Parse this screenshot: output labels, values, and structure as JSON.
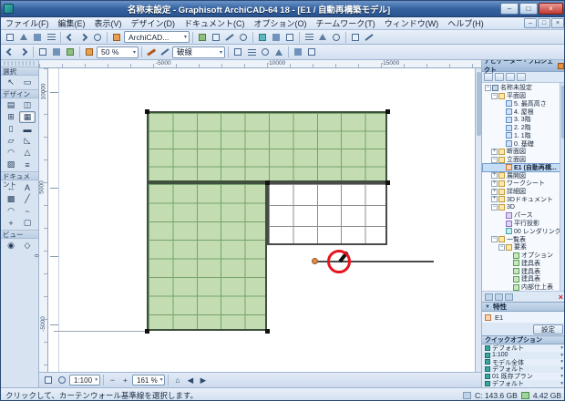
{
  "window": {
    "title": "名称未設定 - Graphisoft ArchiCAD-64 18 - [E1 / 自動再構築モデル]"
  },
  "icons": {
    "minimize": "–",
    "maximize": "□",
    "close": "×",
    "dropdown": "▾",
    "collapse": "▼",
    "zoom_out": "−",
    "zoom_in": "+",
    "fit": "⌂",
    "pan_left": "◀",
    "pan_right": "▶"
  },
  "menu": {
    "items": [
      "ファイル(F)",
      "編集(E)",
      "表示(V)",
      "デザイン(D)",
      "ドキュメント(C)",
      "オプション(O)",
      "チームワーク(T)",
      "ウィンドウ(W)",
      "ヘルプ(H)"
    ]
  },
  "toolbars": {
    "profile_combo": "ArchiCAD...",
    "scale_combo": "50 %",
    "linetype_combo": "破線"
  },
  "palette": {
    "sections": [
      {
        "label": "選択",
        "tools": [
          {
            "name": "arrow",
            "glyph": "↖"
          },
          {
            "name": "marquee",
            "glyph": "▭"
          }
        ]
      },
      {
        "label": "デザイン",
        "tools": [
          {
            "name": "wall",
            "glyph": "▤"
          },
          {
            "name": "door",
            "glyph": "◫"
          },
          {
            "name": "window",
            "glyph": "⊞"
          },
          {
            "name": "curtain-wall",
            "glyph": "▦"
          },
          {
            "name": "column",
            "glyph": "▯"
          },
          {
            "name": "beam",
            "glyph": "▬"
          },
          {
            "name": "slab",
            "glyph": "▱"
          },
          {
            "name": "roof",
            "glyph": "◺"
          },
          {
            "name": "shell",
            "glyph": "◠"
          },
          {
            "name": "mesh",
            "glyph": "△"
          },
          {
            "name": "zone",
            "glyph": "▨"
          },
          {
            "name": "stair",
            "glyph": "≡"
          }
        ]
      },
      {
        "label": "ドキュメント",
        "tools": [
          {
            "name": "dimension",
            "glyph": "↔"
          },
          {
            "name": "text",
            "glyph": "A"
          },
          {
            "name": "fill",
            "glyph": "▩"
          },
          {
            "name": "line",
            "glyph": "╱"
          },
          {
            "name": "arc",
            "glyph": "◠"
          },
          {
            "name": "spline",
            "glyph": "~"
          },
          {
            "name": "hotspot",
            "glyph": "+"
          },
          {
            "name": "figure",
            "glyph": "▢"
          }
        ]
      },
      {
        "label": "ビュー",
        "tools": [
          {
            "name": "camera",
            "glyph": "◉"
          },
          {
            "name": "path",
            "glyph": "◇"
          }
        ]
      }
    ]
  },
  "rulers": {
    "top": [
      "-5000",
      "-10000",
      "-15000"
    ],
    "left": [
      "10000",
      "5000",
      "0",
      "-5000"
    ]
  },
  "navigator": {
    "title": "ナビゲーター - プロジェクト",
    "tree": [
      {
        "label": "名称未設定"
      },
      {
        "label": "平面図"
      },
      {
        "label": "5. 最高高さ"
      },
      {
        "label": "4. 屋根"
      },
      {
        "label": "3. 3階"
      },
      {
        "label": "2. 2階"
      },
      {
        "label": "1. 1階"
      },
      {
        "label": "0. 基礎"
      },
      {
        "label": "断面図"
      },
      {
        "label": "立面図"
      },
      {
        "label": "E1 (自動再構..."
      },
      {
        "label": "展開図"
      },
      {
        "label": "ワークシート"
      },
      {
        "label": "詳細図"
      },
      {
        "label": "3Dドキュメント"
      },
      {
        "label": "3D"
      },
      {
        "label": "パース"
      },
      {
        "label": "平行投影"
      },
      {
        "label": "00 レンダリング"
      },
      {
        "label": "一覧表"
      },
      {
        "label": "要素"
      },
      {
        "label": "オプション"
      },
      {
        "label": "建具表"
      },
      {
        "label": "建具表"
      },
      {
        "label": "建具表"
      },
      {
        "label": "内部仕上表"
      }
    ],
    "properties": {
      "header": "特性",
      "item": "E1",
      "settings": "設定"
    },
    "quick": {
      "title": "クイックオプション",
      "rows": [
        "デフォルト",
        "1:100",
        "モデル全体",
        "デフォルト",
        "01 既存プラン",
        "デフォルト"
      ]
    }
  },
  "bottombar": {
    "scale": "1:100",
    "zoom": "161 %"
  },
  "statusbar": {
    "hint": "クリックして、カーテンウォール基準線を選択します。",
    "disk": "C: 143.6 GB",
    "memory": "4.42 GB"
  }
}
